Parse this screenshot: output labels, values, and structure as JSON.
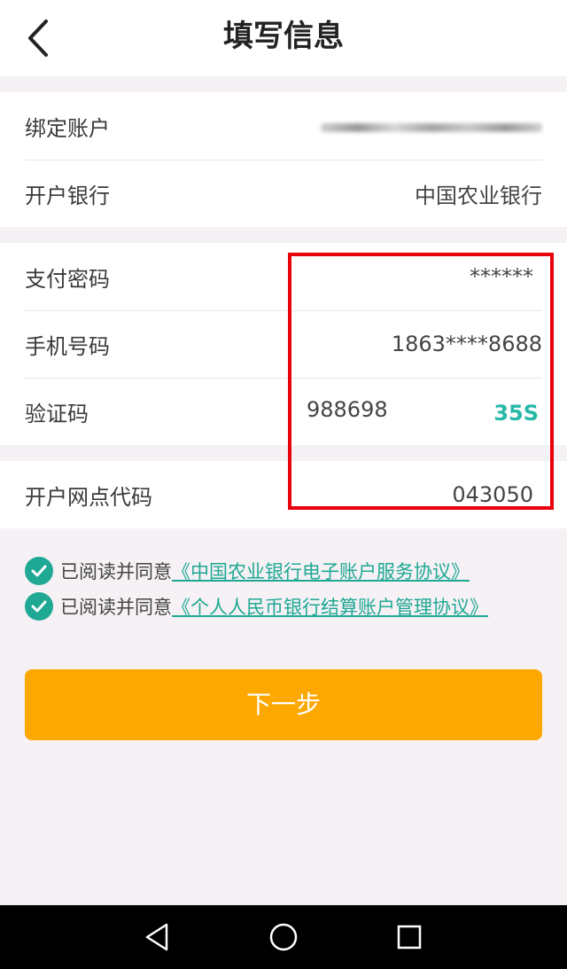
{
  "header": {
    "title": "填写信息",
    "back_icon": "chevron-left-icon"
  },
  "account_section": {
    "bind_account_label": "绑定账户",
    "bank_label": "开户银行",
    "bank_value": "中国农业银行"
  },
  "verify_section": {
    "pay_password_label": "支付密码",
    "pay_password_value": "******",
    "phone_label": "手机号码",
    "phone_value": "1863****8688",
    "code_label": "验证码",
    "code_value": "988698",
    "countdown": "35S"
  },
  "branch_section": {
    "branch_code_label": "开户网点代码",
    "branch_code_value": "043050"
  },
  "agreements": [
    {
      "prefix": "已阅读并同意",
      "link": "《中国农业银行电子账户服务协议》",
      "checked": true
    },
    {
      "prefix": "已阅读并同意",
      "link": "《个人人民币银行结算账户管理协议》",
      "checked": true
    }
  ],
  "next_button": "下一步",
  "colors": {
    "accent_teal": "#1fa894",
    "button_orange": "#fda800",
    "highlight_red": "#e8000b",
    "background": "#f5f1f5"
  },
  "nav_icons": [
    "back-triangle-icon",
    "home-circle-icon",
    "recent-square-icon"
  ]
}
